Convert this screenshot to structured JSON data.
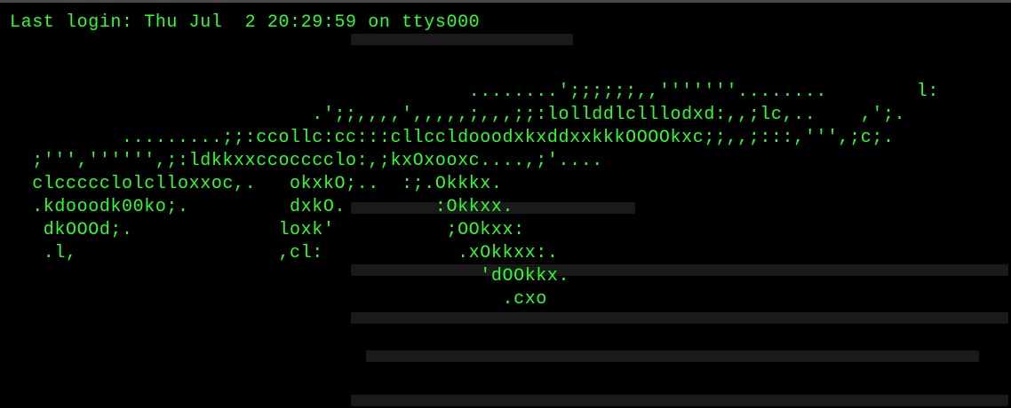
{
  "terminal": {
    "lines": [
      "Last login: Thu Jul  2 20:29:59 on ttys000",
      "",
      "",
      "                                         ........';;;;;;,,'''''''........        l:",
      "                           .';;,,,,',,,,,;,,,;;:lollddlclllodxd:,,;lc,..    ,';.",
      "          .........;;:ccollc:cc:::cllccldooodxkxddxxkkkOOOOkxc;;,,;:::,''',;c;.",
      "  ;''','''''',;:ldkkxxccocccclo:,;kxOxooxc....,;'....",
      "  clccccclolclloxxoc,.   okxkO;..  :;.Okkkx.",
      "  .kdooodk00ko;.         dxkO.        :Okkxx.",
      "   dkOOOd;.             loxk'          ;OOkxx:",
      "   .l,                  ,cl:            .xOkkxx:.",
      "                                          'dOOkkx.",
      "                                            .cxo"
    ],
    "text_color": "#2cff2c",
    "background_color": "#000000"
  }
}
